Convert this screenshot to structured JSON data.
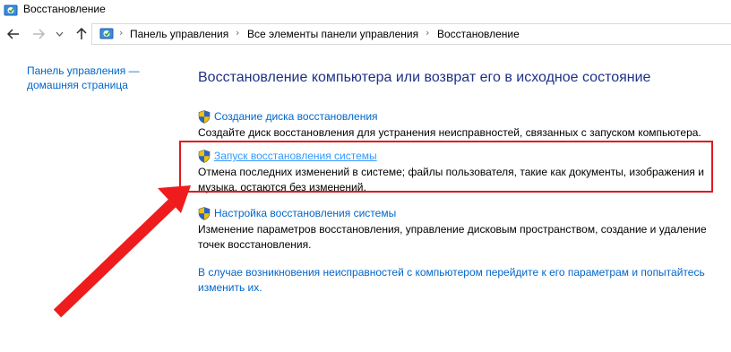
{
  "window": {
    "title": "Восстановление"
  },
  "nav": {
    "breadcrumbs": [
      "Панель управления",
      "Все элементы панели управления",
      "Восстановление"
    ]
  },
  "left_pane": {
    "home_link": "Панель управления — домашняя страница"
  },
  "main": {
    "heading": "Восстановление компьютера или возврат его в исходное состояние",
    "tasks": [
      {
        "link": "Создание диска восстановления",
        "description": "Создайте диск восстановления для устранения неисправностей, связанных с запуском компьютера."
      },
      {
        "link": "Запуск восстановления системы",
        "description": "Отмена последних изменений в системе; файлы пользователя, такие как документы, изображения и музыка, остаются без изменений."
      },
      {
        "link": "Настройка восстановления системы",
        "description": "Изменение параметров восстановления, управление дисковым пространством, создание и удаление точек восстановления."
      }
    ],
    "bottom_link": "В случае возникновения неисправностей с компьютером перейдите к его параметрам и попытайтесь изменить их."
  },
  "colors": {
    "link": "#0066cc",
    "heading": "#1e3287",
    "highlight": "#e0181f",
    "arrow": "#ee1c1c"
  },
  "icons": {
    "title": "control-panel-icon",
    "task": "uac-shield-icon"
  }
}
